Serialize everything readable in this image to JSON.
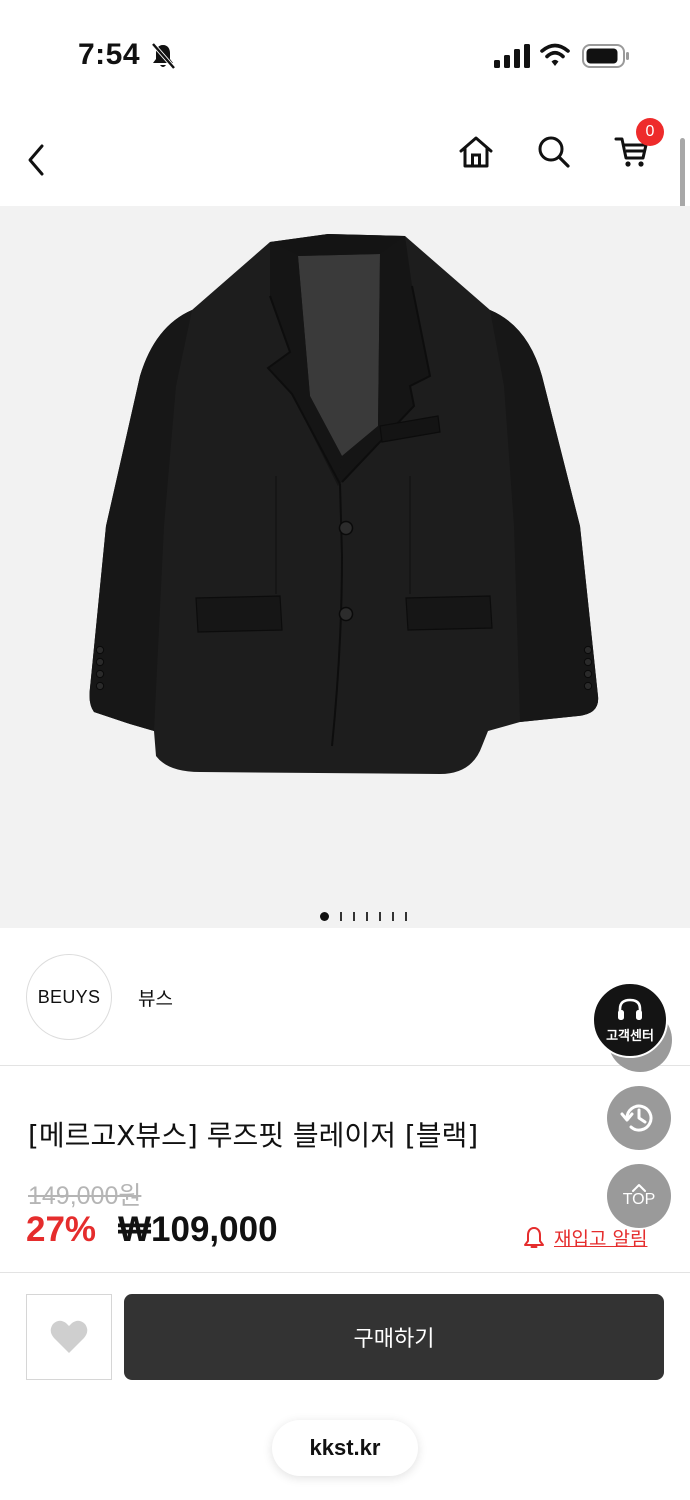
{
  "status_bar": {
    "time": "7:54",
    "icons": [
      "bell-slash-icon",
      "cellular-signal-icon",
      "wifi-icon",
      "battery-icon"
    ]
  },
  "header": {
    "icons": [
      "chevron-left-icon",
      "home-icon",
      "search-icon",
      "cart-icon"
    ],
    "cart_count": "0"
  },
  "gallery": {
    "image": "black-blazer-photo",
    "page_count": 7,
    "current_page": 1
  },
  "brand": {
    "logo_text": "BEUYS",
    "name": "뷰스"
  },
  "product": {
    "title": "[메르고X뷰스] 루즈핏 블레이저 [블랙]",
    "original_price": "149,000원",
    "discount": "27%",
    "price": "₩109,000",
    "restock_label": "재입고 알림"
  },
  "actions": {
    "buy_label": "구매하기",
    "wishlist_icon": "heart-icon"
  },
  "floating": {
    "customer_center_label": "고객센터",
    "top_label": "TOP"
  },
  "browser": {
    "domain": "kkst.kr"
  },
  "colors": {
    "accent_red": "#e52d2d",
    "badge_red": "#ee2b2b",
    "buy_button": "#333333",
    "gallery_bg": "#f2f2f2"
  }
}
